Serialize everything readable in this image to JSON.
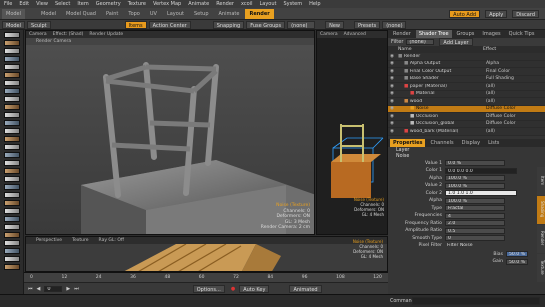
{
  "menu": [
    "File",
    "Edit",
    "View",
    "Select",
    "Item",
    "Geometry",
    "Texture",
    "Vertex Map",
    "Animate",
    "Render",
    "xcoil",
    "Layout",
    "System",
    "Help"
  ],
  "toolbar": {
    "model_label": "Model",
    "tabs": [
      "Model",
      "Model Quad",
      "Paint",
      "Topo",
      "UV",
      "Layout",
      "Setup",
      "Animate",
      "Render"
    ],
    "active_tab": "Render",
    "right_buttons": [
      "Auto Add",
      "Apply",
      "Discard"
    ]
  },
  "toolbar2": {
    "model_btn": "Model",
    "sculpt_btn": "Sculpt",
    "items_btn": "Items",
    "action_center": "Action Center",
    "snapping": "Snapping",
    "falloff": "Falloff",
    "fuse_groups": "Fuse Groups",
    "items_dropdown": "(none)",
    "new": "New",
    "presets": "Presets",
    "presets_value": "(none)"
  },
  "viewport_main": {
    "tabs": [
      "Camera",
      "Effect: (Shad)",
      "Render Update"
    ],
    "subheader": "Render Camera",
    "overlay": {
      "line1": "Noise (Texture)",
      "line2": "Channels: 0",
      "line3": "Deformers: ON",
      "line4": "GL: 3 Mesh",
      "line5": "Render Camera: 2 cm"
    }
  },
  "viewport_side": {
    "tabs": [
      "Camera",
      "Advanced"
    ],
    "overlay": {
      "line1": "Noise (Texture)",
      "line2": "Channels: 0",
      "line3": "Deformers: ON",
      "line4": "GL: 4 Mesh"
    }
  },
  "viewport_bottom": {
    "tabs": [
      "Perspective",
      "Texture",
      "Ray GL: Off"
    ],
    "overlay": {
      "line1": "Noise (Texture)",
      "line2": "Channels: 0",
      "line3": "Deformers: ON",
      "line4": "GL: 4 Mesh"
    }
  },
  "shader_tree": {
    "tabs": [
      "Render",
      "Shader Tree",
      "Groups",
      "Images",
      "Quick Tips"
    ],
    "active_tab": "Shader Tree",
    "filter_label": "Filter",
    "filter_value": "(none)",
    "add_layer": "Add Layer",
    "columns": [
      "Name",
      "Effect"
    ],
    "rows": [
      {
        "name": "Render",
        "effect": ""
      },
      {
        "name": "Alpha Output",
        "effect": "Alpha"
      },
      {
        "name": "Final Color Output",
        "effect": "Final Color"
      },
      {
        "name": "Base Shader",
        "effect": "Full Shading"
      },
      {
        "name": "paper (Material)",
        "effect": "(all)"
      },
      {
        "name": "Material",
        "effect": "(all)"
      },
      {
        "name": "wood",
        "effect": "(all)"
      },
      {
        "name": "Noise",
        "effect": "Diffuse Color"
      },
      {
        "name": "Occlusion",
        "effect": "Diffuse Color"
      },
      {
        "name": "Occlusion_global",
        "effect": "Diffuse Color"
      },
      {
        "name": "wood_bark (Material)",
        "effect": "(all)"
      }
    ],
    "selected_index": 7
  },
  "properties": {
    "tabs": [
      "Properties",
      "Channels",
      "Display",
      "Lists"
    ],
    "active_tab": "Properties",
    "section_layer": "Layer",
    "section_noise": "Noise",
    "rows": [
      {
        "label": "Value 1",
        "value": "0.0 %"
      },
      {
        "label": "Color 1",
        "value": "0.0 0.0 0.0"
      },
      {
        "label": "Alpha",
        "value": "100.0 %"
      },
      {
        "label": "Value 2",
        "value": "100.0 %"
      },
      {
        "label": "Color 2",
        "value": "1.0 1.0 1.0"
      },
      {
        "label": "Alpha",
        "value": "100.0 %"
      },
      {
        "label": "Type",
        "value": "Fractal"
      },
      {
        "label": "Frequencies",
        "value": "4"
      },
      {
        "label": "Frequency Ratio",
        "value": "2.0"
      },
      {
        "label": "Amplitude Ratio",
        "value": "0.5"
      },
      {
        "label": "Smooth Type",
        "value": "0"
      },
      {
        "label": "Pixel Filter",
        "value": "Filter Noise"
      }
    ],
    "bias_label": "Bias",
    "bias_value": "50.0 %",
    "gain_label": "Gain",
    "gain_value": "50.0 %",
    "side_tabs": [
      "Item",
      "Shading",
      "Render",
      "Texture"
    ]
  },
  "timeline": {
    "ticks": [
      "0",
      "12",
      "24",
      "36",
      "48",
      "60",
      "72",
      "84",
      "96",
      "108",
      "120"
    ],
    "options_label": "Options...",
    "auto_key": "Auto Key",
    "animated": "Animated",
    "frame": "0"
  },
  "command_label": "Command"
}
